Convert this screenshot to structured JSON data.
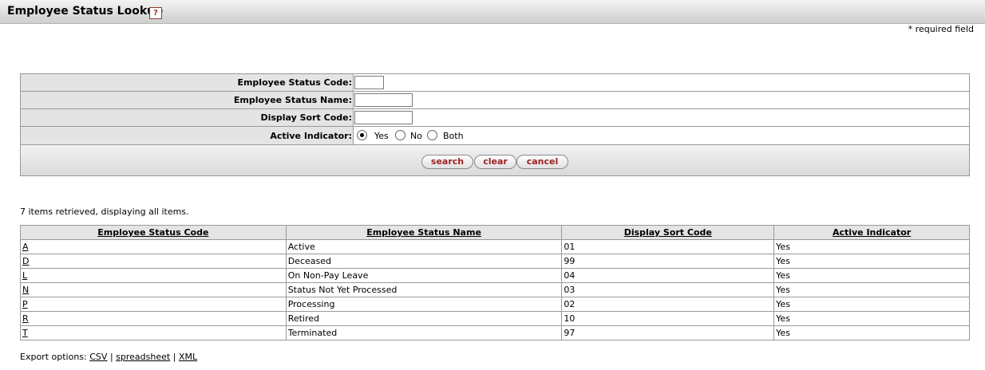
{
  "page": {
    "title": "Employee Status Lookup",
    "help_icon": "?",
    "required_note": "* required field"
  },
  "search_form": {
    "fields": [
      {
        "label": "Employee Status Code:",
        "value": ""
      },
      {
        "label": "Employee Status Name:",
        "value": ""
      },
      {
        "label": "Display Sort Code:",
        "value": ""
      }
    ],
    "active_indicator": {
      "label": "Active Indicator:",
      "options": [
        "Yes",
        "No",
        "Both"
      ],
      "selected": "Yes"
    },
    "buttons": {
      "search": "search",
      "clear": "clear",
      "cancel": "cancel"
    }
  },
  "results": {
    "summary": "7 items retrieved, displaying all items.",
    "columns": [
      "Employee Status Code",
      "Employee Status Name",
      "Display Sort Code",
      "Active Indicator"
    ],
    "rows": [
      {
        "code": "A",
        "name": "Active",
        "sort": "01",
        "active": "Yes"
      },
      {
        "code": "D",
        "name": "Deceased",
        "sort": "99",
        "active": "Yes"
      },
      {
        "code": "L",
        "name": "On Non-Pay Leave",
        "sort": "04",
        "active": "Yes"
      },
      {
        "code": "N",
        "name": "Status Not Yet Processed",
        "sort": "03",
        "active": "Yes"
      },
      {
        "code": "P",
        "name": "Processing",
        "sort": "02",
        "active": "Yes"
      },
      {
        "code": "R",
        "name": "Retired",
        "sort": "10",
        "active": "Yes"
      },
      {
        "code": "T",
        "name": "Terminated",
        "sort": "97",
        "active": "Yes"
      }
    ]
  },
  "export": {
    "label": "Export options:",
    "links": [
      "CSV",
      "spreadsheet",
      "XML"
    ],
    "separator": "|"
  }
}
